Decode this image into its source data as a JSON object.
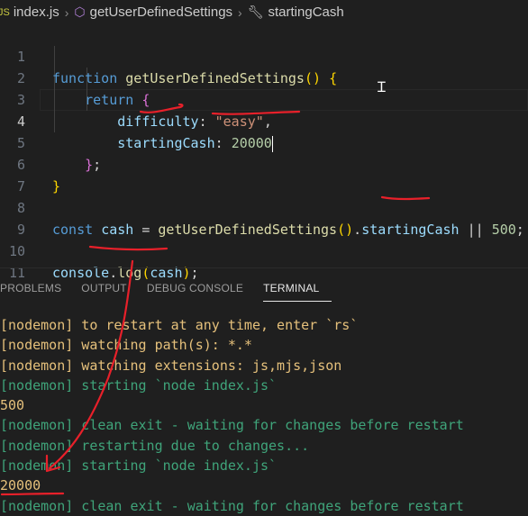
{
  "breadcrumb": {
    "file": "index.js",
    "function": "getUserDefinedSettings",
    "property": "startingCash"
  },
  "editor": {
    "lines": [
      {
        "n": "1"
      },
      {
        "n": "2"
      },
      {
        "n": "3"
      },
      {
        "n": "4"
      },
      {
        "n": "5"
      },
      {
        "n": "6"
      },
      {
        "n": "7"
      },
      {
        "n": "8"
      },
      {
        "n": "9"
      },
      {
        "n": "10"
      },
      {
        "n": "11"
      }
    ],
    "code": {
      "l1_kw": "function",
      "l1_fn": "getUserDefinedSettings",
      "l1_rest_open": "()",
      "l1_brace": "{",
      "l2_kw": "return",
      "l2_brace": "{",
      "l3_prop": "difficulty",
      "l3_colon": ": ",
      "l3_str": "\"easy\"",
      "l3_comma": ",",
      "l4_prop": "startingCash",
      "l4_colon": ": ",
      "l4_num": "20000",
      "l5_brace": "}",
      "l5_semi": ";",
      "l6_brace": "}",
      "l8_kw": "const",
      "l8_var": "cash",
      "l8_eq": " = ",
      "l8_fn": "getUserDefinedSettings",
      "l8_paren": "()",
      "l8_dot": ".",
      "l8_prop": "startingCash",
      "l8_or": " || ",
      "l8_num": "500",
      "l8_semi": ";",
      "l10_obj": "console",
      "l10_dot": ".",
      "l10_fn": "log",
      "l10_open": "(",
      "l10_arg": "cash",
      "l10_close": ")",
      "l10_semi": ";"
    }
  },
  "panel": {
    "tabs": [
      {
        "label": "PROBLEMS"
      },
      {
        "label": "OUTPUT"
      },
      {
        "label": "DEBUG CONSOLE"
      },
      {
        "label": "TERMINAL"
      }
    ],
    "active_tab": "TERMINAL"
  },
  "terminal": {
    "lines": [
      {
        "text": "[nodemon] to restart at any time, enter `rs`"
      },
      {
        "text": "[nodemon] watching path(s): *.*"
      },
      {
        "text": "[nodemon] watching extensions: js,mjs,json"
      },
      {
        "text": "[nodemon] starting `node index.js`"
      },
      {
        "text": "500"
      },
      {
        "text": "[nodemon] clean exit - waiting for changes before restart"
      },
      {
        "text": "[nodemon] restarting due to changes..."
      },
      {
        "text": "[nodemon] starting `node index.js`"
      },
      {
        "text": "20000"
      },
      {
        "text": "[nodemon] clean exit - waiting for changes before restart"
      }
    ]
  },
  "colors": {
    "background": "#1f1f1f",
    "keyword": "#569cd6",
    "function": "#dcdcaa",
    "property": "#9cdcfe",
    "string": "#ce9178",
    "number": "#b5cea8",
    "terminal_yellow": "#e5c07b",
    "terminal_green": "#3fa47a",
    "annotation_red": "#e8202a"
  }
}
